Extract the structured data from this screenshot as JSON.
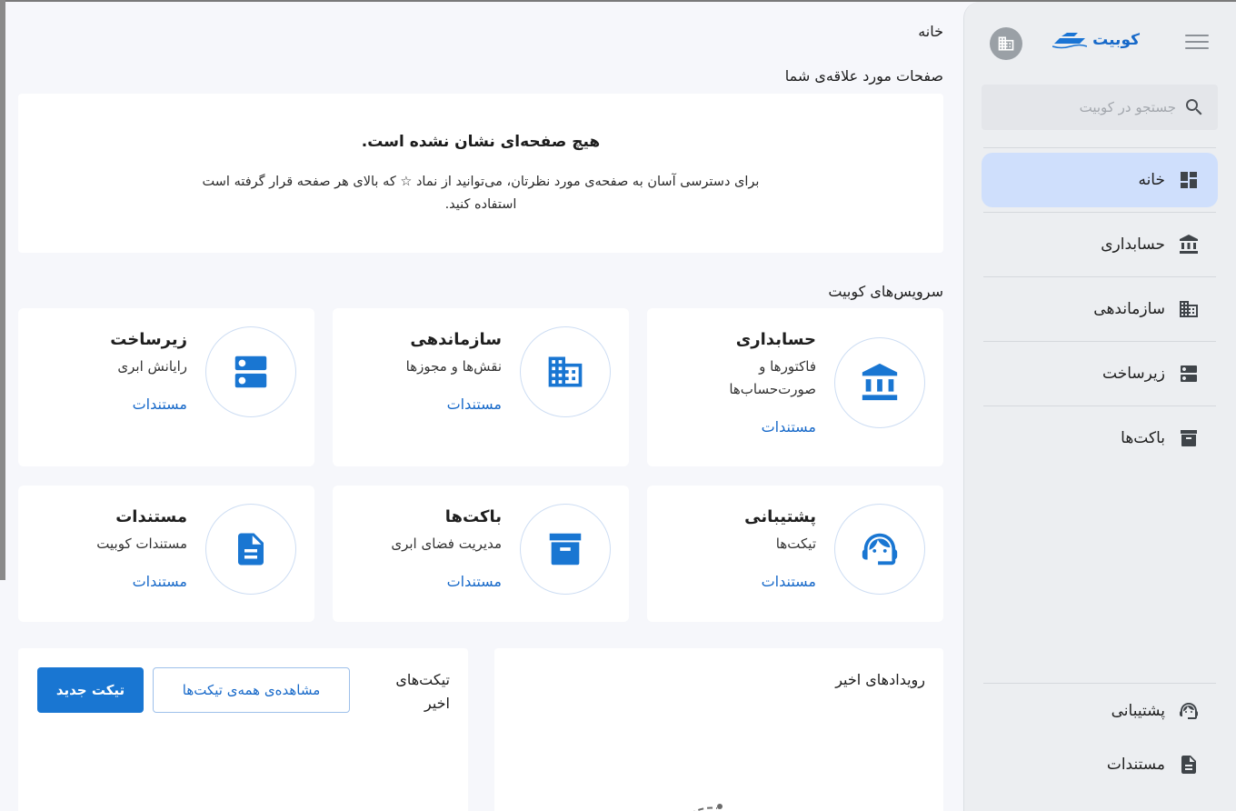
{
  "sidebar": {
    "logo_text": "کوبیت",
    "search_placeholder": "جستجو در کوبیت",
    "items": [
      {
        "label": "خانه",
        "icon": "dashboard-icon",
        "active": true
      },
      {
        "label": "حسابداری",
        "icon": "bank-icon"
      },
      {
        "label": "سازماندهی",
        "icon": "building-icon"
      },
      {
        "label": "زیرساخت",
        "icon": "server-icon"
      },
      {
        "label": "باکت‌ها",
        "icon": "archive-icon"
      }
    ],
    "footer_items": [
      {
        "label": "پشتیبانی",
        "icon": "support-agent-icon"
      },
      {
        "label": "مستندات",
        "icon": "document-icon"
      }
    ]
  },
  "main": {
    "breadcrumb": "خانه",
    "favorites": {
      "title": "صفحات مورد علاقه‌ی شما",
      "empty_title": "هیچ صفحه‌ای نشان نشده است.",
      "empty_text": "برای دسترسی آسان به صفحه‌ی مورد نظرتان، می‌توانید از نماد ☆ که بالای هر صفحه قرار گرفته است استفاده کنید."
    },
    "services": {
      "title": "سرویس‌های کوبیت",
      "cards": [
        {
          "title": "حسابداری",
          "desc": "فاکتورها و صورت‌حساب‌ها",
          "link": "مستندات",
          "icon": "bank-icon"
        },
        {
          "title": "سازماندهی",
          "desc": "نقش‌ها و مجوزها",
          "link": "مستندات",
          "icon": "building-icon"
        },
        {
          "title": "زیرساخت",
          "desc": "رایانش ابری",
          "link": "مستندات",
          "icon": "server-icon"
        },
        {
          "title": "پشتیبانی",
          "desc": "تیکت‌ها",
          "link": "مستندات",
          "icon": "support-agent-icon"
        },
        {
          "title": "باکت‌ها",
          "desc": "مدیریت فضای ابری",
          "link": "مستندات",
          "icon": "archive-icon"
        },
        {
          "title": "مستندات",
          "desc": "مستندات کوبیت",
          "link": "مستندات",
          "icon": "document-icon"
        }
      ]
    },
    "events": {
      "title": "رویدادهای اخیر"
    },
    "tickets": {
      "title": "تیکت‌های اخیر",
      "view_all_label": "مشاهده‌ی همه‌ی تیکت‌ها",
      "new_ticket_label": "تیکت جدید"
    }
  },
  "colors": {
    "accent": "#1976d2",
    "active_nav": "#cfdffc",
    "sidebar_bg": "#eceef1"
  }
}
